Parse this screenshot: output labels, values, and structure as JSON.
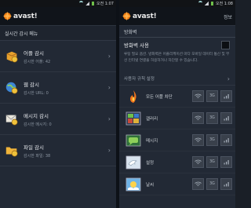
{
  "status": {
    "time": "오전 1:07",
    "time2": "오전 1:08"
  },
  "left": {
    "app_name": "avast!",
    "section_title": "실시간 감시 메뉴",
    "items": [
      {
        "title": "어플 감시",
        "sub": "감시한 어플: 42",
        "icon": "box-shield-icon"
      },
      {
        "title": "웹 감시",
        "sub": "감시한 URL: 0",
        "icon": "globe-shield-icon"
      },
      {
        "title": "메시지 감시",
        "sub": "감시한 메시지: 0",
        "icon": "envelope-shield-icon"
      },
      {
        "title": "파일 감시",
        "sub": "감시한 파일: 38",
        "icon": "folder-shield-icon"
      }
    ]
  },
  "right": {
    "app_name": "avast!",
    "action": "정보",
    "section_title": "방화벽",
    "toggle_label": "방화벽 사용",
    "description": "루팅 필요 옵션. 방화벽은 어플리케이션 마다 모바일 데이터 통신 및 무선 인터넷 연결을 허용하거나 차단할 수 있습니다.",
    "setting_label": "사용자 규칙 설정",
    "apps": [
      {
        "name": "모든 어플 차단"
      },
      {
        "name": "갤러리"
      },
      {
        "name": "메시지"
      },
      {
        "name": "설정"
      },
      {
        "name": "날씨"
      }
    ],
    "btn_labels": {
      "wifi": "Wi-Fi",
      "three_g": "3G",
      "roaming": "Roam"
    }
  }
}
